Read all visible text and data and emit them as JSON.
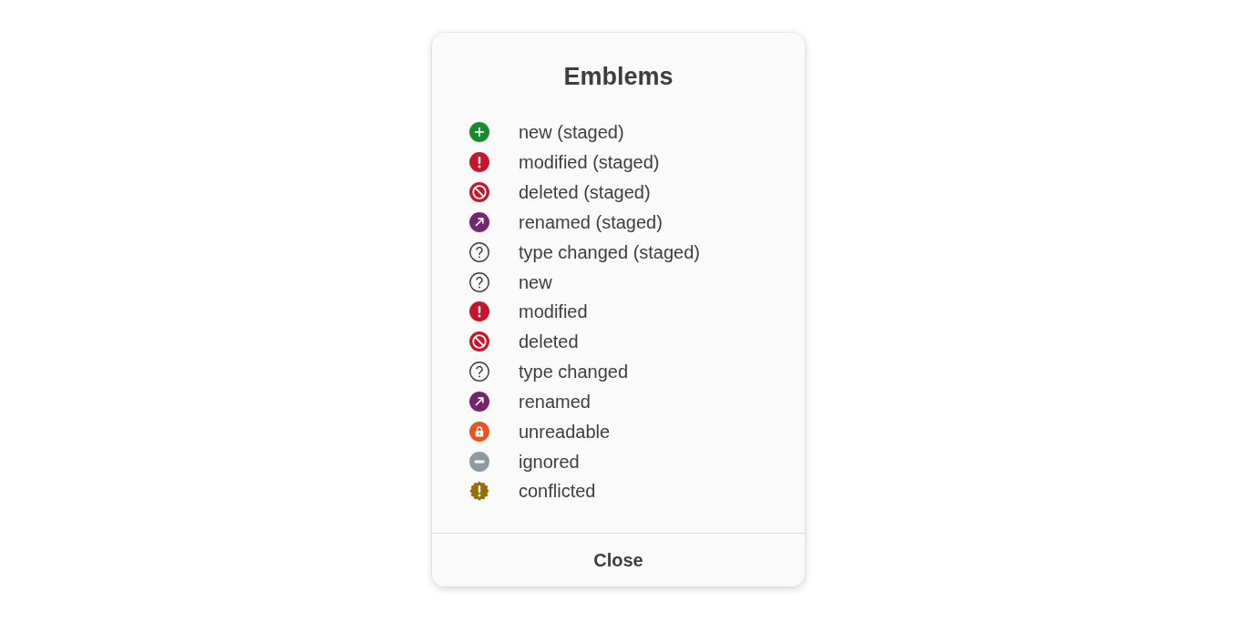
{
  "dialog": {
    "title": "Emblems",
    "emblems": [
      {
        "kind": "added",
        "label": "new (staged)"
      },
      {
        "kind": "modified",
        "label": "modified (staged)"
      },
      {
        "kind": "deleted",
        "label": "deleted (staged)"
      },
      {
        "kind": "renamed",
        "label": "renamed (staged)"
      },
      {
        "kind": "unknown",
        "label": "type changed (staged)"
      },
      {
        "kind": "unknown",
        "label": "new"
      },
      {
        "kind": "modified",
        "label": "modified"
      },
      {
        "kind": "deleted",
        "label": "deleted"
      },
      {
        "kind": "unknown",
        "label": "type changed"
      },
      {
        "kind": "renamed",
        "label": "renamed"
      },
      {
        "kind": "unreadable",
        "label": "unreadable"
      },
      {
        "kind": "ignored",
        "label": "ignored"
      },
      {
        "kind": "conflicted",
        "label": "conflicted"
      }
    ],
    "button": "Close"
  }
}
